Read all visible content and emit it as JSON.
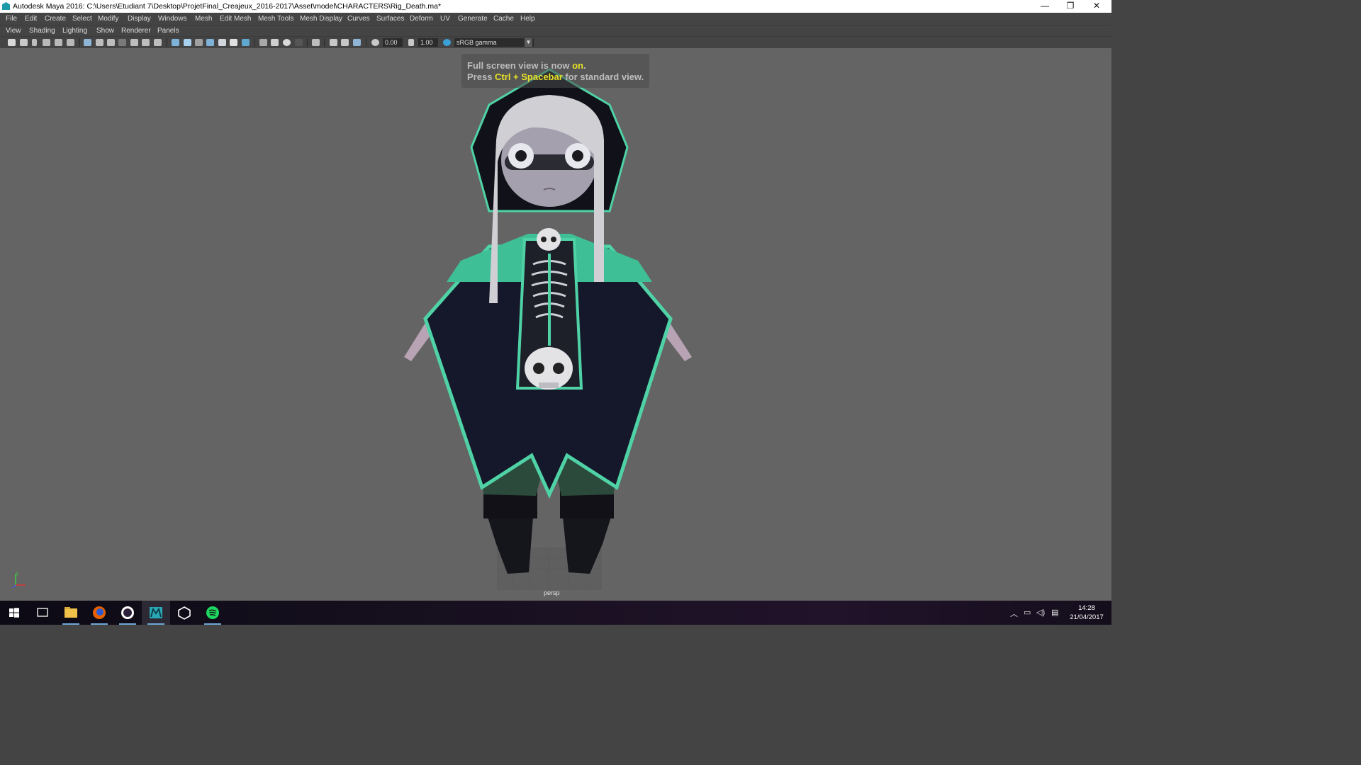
{
  "window": {
    "title": "Autodesk Maya 2016: C:\\Users\\Etudiant 7\\Desktop\\ProjetFinal_Creajeux_2016-2017\\Asset\\model\\CHARACTERS\\Rig_Death.ma*",
    "minimize": "—",
    "restore": "❐",
    "close": "✕"
  },
  "menubar": [
    "File",
    "Edit",
    "Create",
    "Select",
    "Modify",
    "Display",
    "Windows",
    "Mesh",
    "Edit Mesh",
    "Mesh Tools",
    "Mesh Display",
    "Curves",
    "Surfaces",
    "Deform",
    "UV",
    "Generate",
    "Cache",
    "Help"
  ],
  "panel_menu": [
    "View",
    "Shading",
    "Lighting",
    "Show",
    "Renderer",
    "Panels"
  ],
  "toolbar": {
    "exposure": "0.00",
    "gamma": "1.00",
    "color_space": "sRGB gamma"
  },
  "viewport": {
    "notice_line1_a": "Full screen view is now ",
    "notice_line1_b": "on",
    "notice_line1_c": ".",
    "notice_line2_a": "Press ",
    "notice_line2_b": "Ctrl + Spacebar",
    "notice_line2_c": " for standard view.",
    "camera": "persp",
    "axis_y": "y"
  },
  "taskbar": {
    "time": "14:28",
    "date": "21/04/2017",
    "apps": [
      "start-icon",
      "task-view-icon",
      "file-explorer-icon",
      "firefox-icon",
      "obs-icon",
      "maya-icon",
      "unity-icon",
      "spotify-icon"
    ]
  },
  "colors": {
    "accent_teal": "#4fd3a6",
    "viewport_bg": "#646464",
    "highlight": "#e7e226"
  }
}
